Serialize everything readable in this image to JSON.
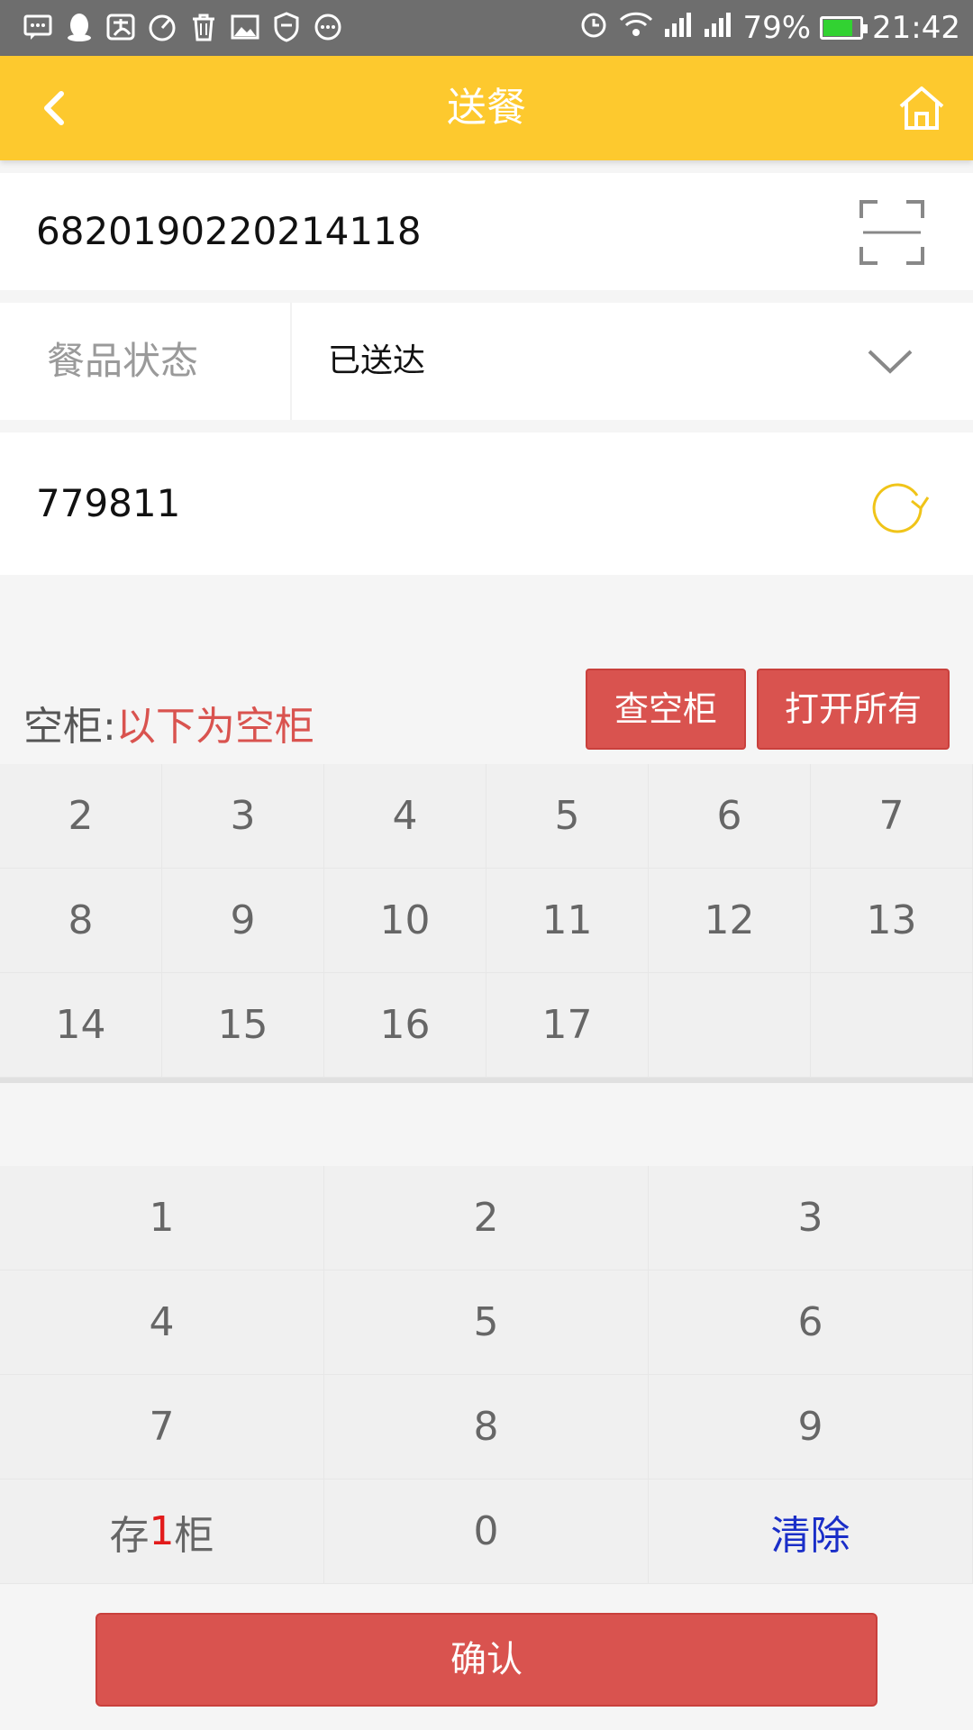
{
  "status_bar": {
    "notification_icons": [
      "message-icon",
      "qq-icon",
      "alipay-icon",
      "speed-icon",
      "trash-icon",
      "image-icon",
      "shield-icon",
      "more-icon"
    ],
    "battery_percent": "79%",
    "battery_level": 0.79,
    "time": "21:42"
  },
  "header": {
    "title": "送餐",
    "accent_color": "#fdc92e"
  },
  "order": {
    "number": "6820190220214118"
  },
  "meal_status": {
    "label": "餐品状态",
    "value": "已送达"
  },
  "pickup_code": {
    "value": "779811"
  },
  "cabinet": {
    "label_prefix": "空柜:",
    "label_note": "以下为空柜",
    "check_button": "查空柜",
    "open_all_button": "打开所有",
    "empty_cabinets": [
      "2",
      "3",
      "4",
      "5",
      "6",
      "7",
      "8",
      "9",
      "10",
      "11",
      "12",
      "13",
      "14",
      "15",
      "16",
      "17"
    ]
  },
  "keypad": {
    "keys": [
      "1",
      "2",
      "3",
      "4",
      "5",
      "6",
      "7",
      "8",
      "9"
    ],
    "store_prefix": "存",
    "store_number": "1",
    "store_suffix": "柜",
    "zero": "0",
    "clear": "清除"
  },
  "confirm_button": "确认"
}
